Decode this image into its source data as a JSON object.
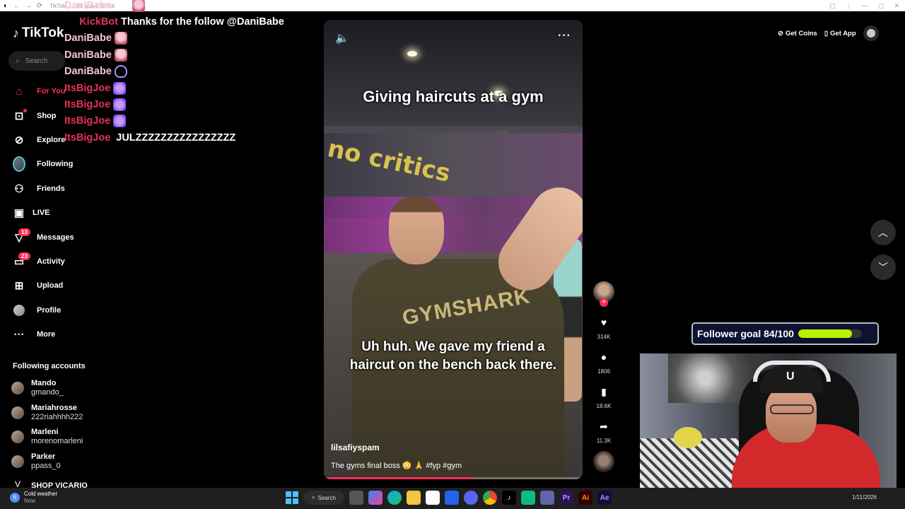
{
  "browser": {
    "tab_title": "TikTok - ... for you | TikTok",
    "back": "←",
    "forward": "→",
    "reload": "⟳"
  },
  "sidebar": {
    "logo": "TikTok",
    "search_placeholder": "Search",
    "nav": [
      {
        "label": "For You",
        "icon": "home-icon",
        "active": true
      },
      {
        "label": "Shop",
        "icon": "shop-bag-icon"
      },
      {
        "label": "Explore",
        "icon": "compass-icon"
      },
      {
        "label": "Following",
        "icon": "following-avatar"
      },
      {
        "label": "Friends",
        "icon": "friends-icon"
      },
      {
        "label": "LIVE",
        "icon": "live-icon"
      },
      {
        "label": "Messages",
        "icon": "paper-plane-icon",
        "badge": "13"
      },
      {
        "label": "Activity",
        "icon": "inbox-icon",
        "badge": "23"
      },
      {
        "label": "Upload",
        "icon": "plus-square-icon"
      },
      {
        "label": "Profile",
        "icon": "profile-avatar"
      },
      {
        "label": "More",
        "icon": "ellipsis-icon"
      }
    ],
    "following_title": "Following accounts",
    "following": [
      {
        "name": "Mando",
        "handle": "gmando_"
      },
      {
        "name": "Mariahrosse",
        "handle": "222riahhhh222"
      },
      {
        "name": "Marleni",
        "handle": "morenomarleni"
      },
      {
        "name": "Parker",
        "handle": "ppass_0"
      },
      {
        "name": "SHOP VICARIO",
        "handle": ""
      }
    ]
  },
  "chat": [
    {
      "user": "DaniBabe",
      "msg": "",
      "emote": "pink",
      "color": "pink"
    },
    {
      "user": "KickBot",
      "msg": "Thanks for the follow @DaniBabe",
      "emote": "",
      "color": "red"
    },
    {
      "user": "DaniBabe",
      "msg": "",
      "emote": "pink",
      "color": "pink"
    },
    {
      "user": "DaniBabe",
      "msg": "",
      "emote": "pink",
      "color": "pink"
    },
    {
      "user": "DaniBabe",
      "msg": "",
      "emote": "heart",
      "color": "pink"
    },
    {
      "user": "ItsBigJoe",
      "msg": "",
      "emote": "purple",
      "color": "magenta"
    },
    {
      "user": "ItsBigJoe",
      "msg": "",
      "emote": "purple",
      "color": "magenta"
    },
    {
      "user": "ItsBigJoe",
      "msg": "",
      "emote": "purple",
      "color": "magenta"
    },
    {
      "user": "ItsBigJoe",
      "msg": "JULZZZZZZZZZZZZZZZZ",
      "emote": "",
      "color": "magenta"
    }
  ],
  "chat_top_partial": "DaniBabe",
  "video": {
    "caption_top": "Giving haircuts at a gym",
    "caption_mid": "Uh huh. We gave my friend a haircut on the bench back there.",
    "wall_text": "no critics",
    "shirt_text": "GYMSHARK",
    "author": "lilsafiyspam",
    "description": "The gyms final boss 😳 🙏 #fyp #gym",
    "progress": 0.57
  },
  "actions": {
    "likes": "314K",
    "comments": "1806",
    "saves": "18.6K",
    "shares": "11.3K"
  },
  "top_right": {
    "coins": "Get Coins",
    "app": "Get App"
  },
  "goal": {
    "label": "Follower goal 84/100",
    "current": 84,
    "target": 100
  },
  "webcam": {
    "cap_logo": "U"
  },
  "taskbar": {
    "weather_title": "Cold weather",
    "weather_sub": "Now",
    "weather_badge": "6",
    "search": "Search",
    "date": "1/11/2026"
  }
}
